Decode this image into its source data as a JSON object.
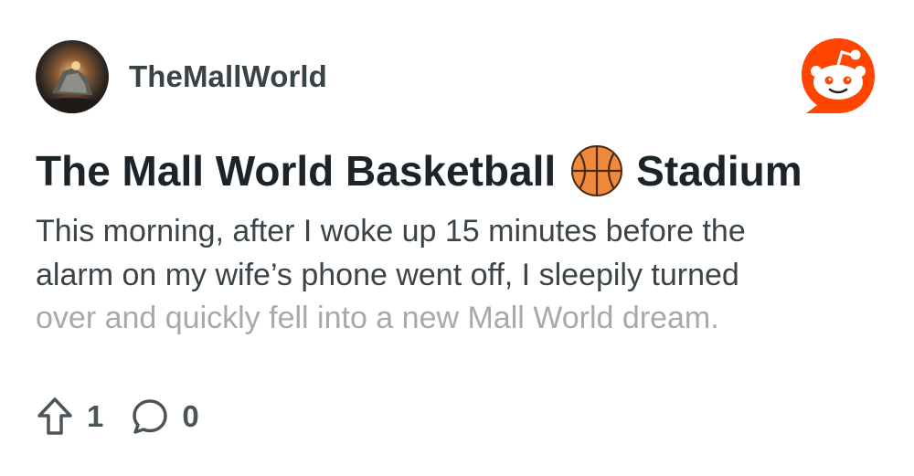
{
  "post": {
    "author": "TheMallWorld",
    "title_before": "The Mall World Basketball",
    "title_after": "Stadium",
    "body_lines": [
      "This morning, after I woke up 15 minutes before the",
      "alarm on my wife’s phone went off, I sleepily turned",
      "over and quickly fell into a new Mall World dream."
    ],
    "upvotes": "1",
    "comments": "0"
  },
  "icons": {
    "avatar": "avatar-image",
    "brand": "reddit-logo-icon",
    "title_emoji": "basketball-icon",
    "upvote": "upvote-arrow-icon",
    "comment": "comment-bubble-icon"
  },
  "colors": {
    "brand": "#ff4500",
    "title": "#1c2429",
    "body": "#3b4449",
    "body_faded": "#a5aaad",
    "meta": "#4b5459",
    "basketball": "#f08a3a"
  }
}
